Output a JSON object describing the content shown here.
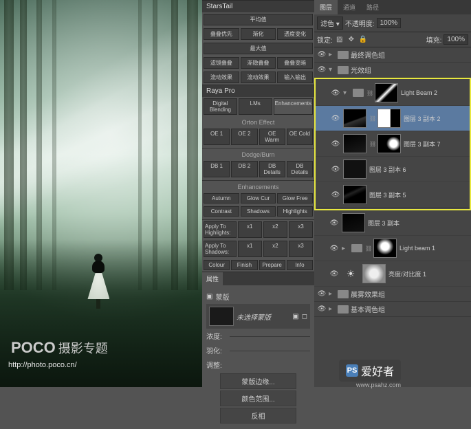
{
  "watermark": {
    "logo": "POCO",
    "logo_sub": "摄影专题",
    "url": "http://photo.poco.cn/",
    "brand_icon": "PS",
    "brand_text": "爱好者",
    "brand_url": "www.psahz.com"
  },
  "starstail": {
    "title": "StarsTail",
    "rows": [
      [
        "平均值",
        "",
        ""
      ],
      [
        "叠叠优先",
        "渐化",
        "透度变化"
      ],
      [
        "最大值",
        "",
        ""
      ],
      [
        "滤镜叠叠",
        "渐隐叠叠",
        "叠叠变暗"
      ],
      [
        "流动效果",
        "流动效果",
        "输入输出"
      ]
    ]
  },
  "rayapro": {
    "title": "Raya Pro",
    "tabs": [
      "Digital Blending",
      "LMs",
      "Enhancements"
    ],
    "orton": {
      "label": "Orton Effect",
      "btns": [
        "OE 1",
        "OE 2",
        "OE Warm",
        "OE Cold"
      ]
    },
    "dodge": {
      "label": "Dodge/Burn",
      "btns": [
        "DB 1",
        "DB 2",
        "DB Details",
        "DB Details"
      ]
    },
    "enh": {
      "label": "Enhancements",
      "row1": [
        "Autumn",
        "Glow Cur",
        "Glow Free"
      ],
      "row2": [
        "Contrast",
        "Shadows",
        "Highlights"
      ]
    },
    "apply_hi": {
      "label": "Apply To Highlights:",
      "btns": [
        "x1",
        "x2",
        "x3"
      ]
    },
    "apply_sh": {
      "label": "Apply To Shadows:",
      "btns": [
        "x1",
        "x2",
        "x3"
      ]
    },
    "bottom": [
      "Colour",
      "Finish",
      "Prepare",
      "Info"
    ]
  },
  "props": {
    "tab": "属性",
    "type": "蒙版",
    "mask_label": "未选择蒙版",
    "density": {
      "label": "浓度:",
      "val": ""
    },
    "feather": {
      "label": "羽化:",
      "val": ""
    },
    "adjust": "调整:",
    "btns": [
      "蒙版边缘...",
      "颜色范围...",
      "反相"
    ]
  },
  "layerspanel": {
    "tabs": [
      "图层",
      "通道",
      "路径"
    ],
    "blend": "滤色",
    "opacity": {
      "label": "不透明度:",
      "val": "100%"
    },
    "lock": "锁定:",
    "fill": {
      "label": "填充:",
      "val": "100%"
    },
    "groups_top": [
      "最终调色组",
      "光效组"
    ],
    "layers": [
      {
        "name": "Light Beam 2",
        "sel": false,
        "mask": true
      },
      {
        "name": "图层 3 副本 2",
        "sel": true,
        "mask": true
      },
      {
        "name": "图层 3 副本 7",
        "sel": false,
        "mask": true
      },
      {
        "name": "图层 3 副本 6",
        "sel": false,
        "mask": false
      },
      {
        "name": "图层 3 副本 5",
        "sel": false,
        "mask": false
      }
    ],
    "layers_below": [
      {
        "name": "图层 3 副本",
        "mask": false
      },
      {
        "name": "Light beam 1",
        "mask": true,
        "folder": true
      },
      {
        "name": "亮度/对比度 1",
        "adj": true
      }
    ],
    "groups_bottom": [
      "晨雾效果组",
      "基本调色组"
    ]
  }
}
